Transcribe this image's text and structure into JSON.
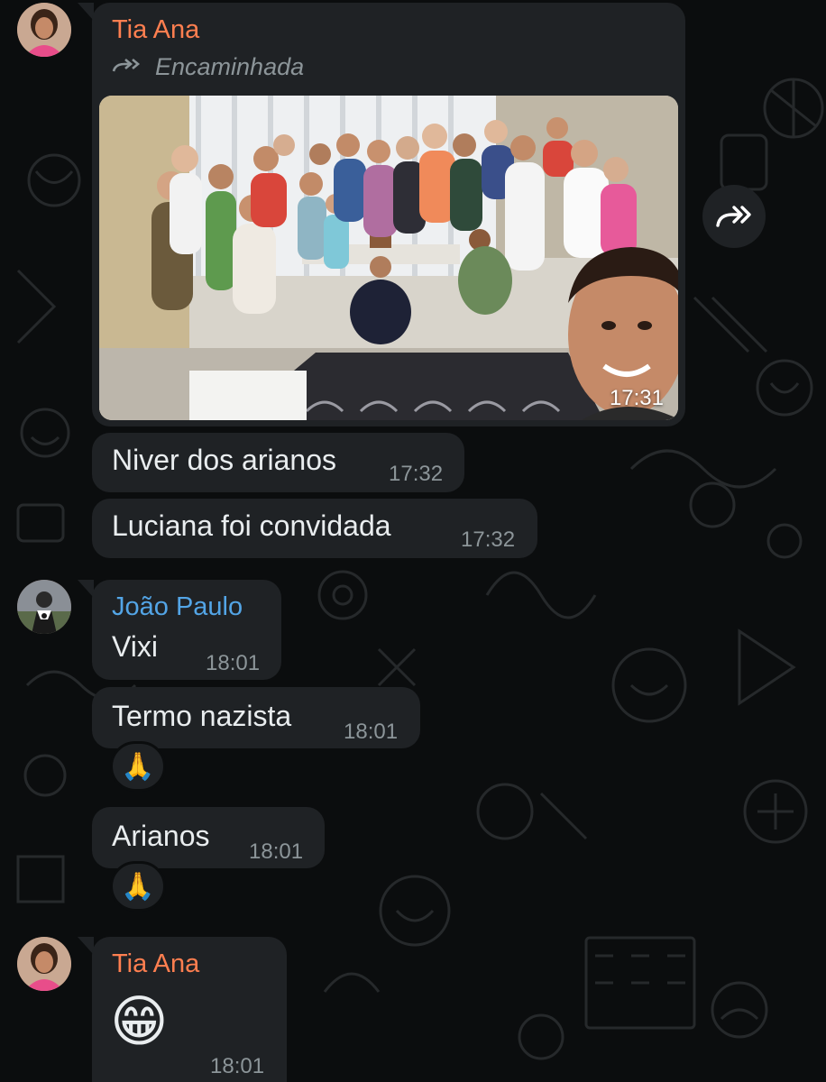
{
  "colors": {
    "background": "#0b0d0e",
    "bubble": "#1f2225",
    "sender_tia_ana": "#ff7f50",
    "sender_joao_paulo": "#53a5e6",
    "text": "#e9edef",
    "timestamp": "#8c9599"
  },
  "messages": [
    {
      "sender": "Tia Ana",
      "forwarded_label": "Encaminhada",
      "media": "photo",
      "time": "17:31"
    },
    {
      "text": "Niver dos arianos",
      "time": "17:32"
    },
    {
      "text": "Luciana foi  convidada",
      "time": "17:32"
    },
    {
      "sender": "João Paulo",
      "text": "Vixi",
      "time": "18:01"
    },
    {
      "text": "Termo nazista",
      "time": "18:01",
      "reaction": "🙏"
    },
    {
      "text": "Arianos",
      "time": "18:01",
      "reaction": "🙏"
    },
    {
      "sender": "Tia Ana",
      "text": "😁",
      "time": "18:01"
    }
  ],
  "icons": {
    "forward_indicator": "forward-arrows-icon",
    "forward_button": "forward-arrow-icon"
  }
}
